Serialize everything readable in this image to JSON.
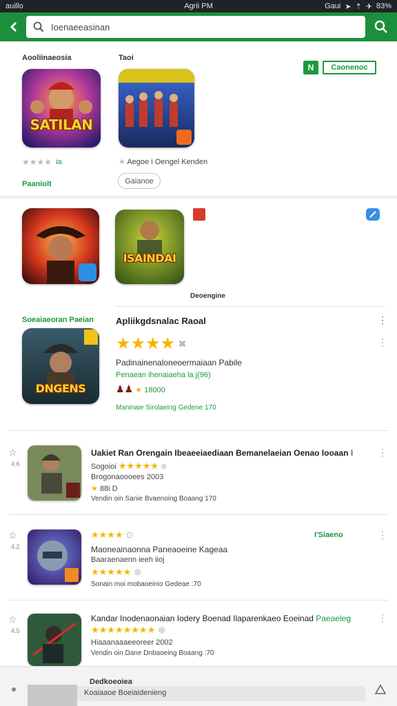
{
  "status_bar": {
    "carrier": "auillo",
    "time": "Agrii PM",
    "signal": "Gaui",
    "battery": "83%"
  },
  "search": {
    "query": "Ioenaeeasinan"
  },
  "featured": {
    "col1_title": "Aooliinaeosia",
    "col2_title": "Taoi",
    "app1": {
      "icon_text": "SATILAN",
      "rating_text": "ia"
    },
    "app2": {
      "line": "Aegoe i Oengel Kenden"
    },
    "promo_link": "Paaniolt",
    "chip": "Gaianoe",
    "badge_icon_text": "N",
    "badge_text": "Caonenoc"
  },
  "row2": {
    "app3": {
      "icon_text": ""
    },
    "app4": {
      "icon_text": "ISAINDAI"
    },
    "caption": "Deoengine"
  },
  "section": {
    "label": "Soeaiaeoran Paeian",
    "app5": {
      "icon_text": "DNGENS",
      "title": "Apliikgdsnalac Raoal",
      "rating": 4,
      "desc": "Padinainenaloneoermaiaan Pabile",
      "meta": "Penaean ihenaiaeha la j(96)",
      "sub": "18000",
      "line": "Maninaie Sirolaeing Gedene 170"
    }
  },
  "list": [
    {
      "title": "Uakiet Ran Orengain Ibeaeeiaediaan Bemanelaeian Oenao Iooaan",
      "tail": "I",
      "rating_line": "Sogoioi",
      "rating": 5,
      "sub": "Brogonaoooees 2003",
      "small": "88i D",
      "small_rating": 1,
      "footer": "Vendin  oin  Sanie Bvaenoing Boaang 170",
      "side": "4.6"
    },
    {
      "title": "Maoneainaonna Paneaoeine Kageaa",
      "tail": "",
      "top_rating": 4,
      "top_right": "I'Siaeno",
      "sub": "Baaraenaenn ieeh iioj",
      "rating": 5,
      "footer": "Sonain  moi  mobaoeinio Gedeae  :70",
      "side": "4.2"
    },
    {
      "title": "Kandar Inodenaonaian Iodery Boenad Ilaparenkaeo Eoeinad",
      "tail": "Paeaeleg",
      "rating": 9,
      "sub": "Hiaaanaaaeeoreer 2002",
      "footer": "Vendin  oin  Dane Dnbaoeing Boaang  :70",
      "side": "4.5"
    }
  ],
  "bottom": {
    "title": "Dedkoeoiea",
    "desc": "Koaiaaoe Boeiaidenieng"
  },
  "colors": {
    "brand": "#1c8f3c",
    "accent": "#1a9a3a",
    "star": "#f6b400"
  }
}
